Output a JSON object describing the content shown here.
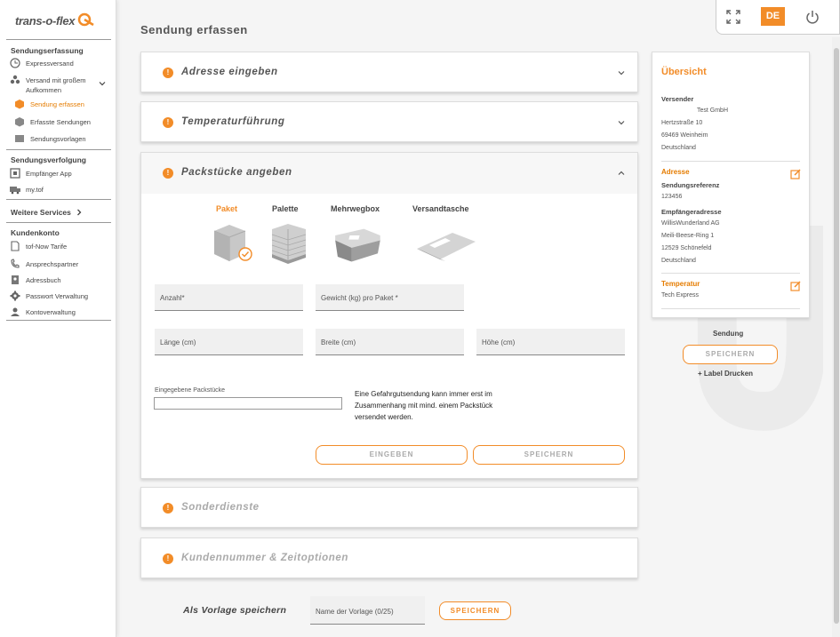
{
  "brand": {
    "logo_text": "trans-o-flex",
    "accent": "#f28c28"
  },
  "sidebar": {
    "sections": [
      {
        "title": "Sendungserfassung",
        "items": [
          {
            "label": "Expressversand",
            "icon": "clock-icon"
          },
          {
            "label": "Versand mit großem Aufkommen",
            "icon": "boxes-icon"
          },
          {
            "label": "Sendung erfassen",
            "icon": "box-icon"
          },
          {
            "label": "Erfasste Sendungen",
            "icon": "box-list-icon"
          },
          {
            "label": "Sendungsvorlagen",
            "icon": "box-template-icon"
          }
        ]
      },
      {
        "title": "Sendungsverfolgung",
        "items": [
          {
            "label": "Empfänger App",
            "icon": "app-icon"
          },
          {
            "label": "my.tof",
            "icon": "truck-icon"
          }
        ]
      },
      {
        "title": "Weitere Services"
      },
      {
        "title": "Kundenkonto",
        "items": [
          {
            "label": "tof-Now Tarife",
            "icon": "pdf-icon"
          },
          {
            "label": "Ansprechspartner",
            "icon": "phone-icon"
          },
          {
            "label": "Adressbuch",
            "icon": "addressbook-icon"
          },
          {
            "label": "Passwort Verwaltung",
            "icon": "gear-icon"
          },
          {
            "label": "Kontoverwaltung",
            "icon": "user-icon"
          }
        ]
      }
    ]
  },
  "top": {
    "lang": "DE"
  },
  "page_title": "Sendung erfassen",
  "cards": {
    "address": "Adresse eingeben",
    "temperature": "Temperaturführung",
    "packages": "Packstücke angeben",
    "special": "Sonderdienste",
    "customer": "Kundennummer & Zeitoptionen"
  },
  "package_types": [
    "Paket",
    "Palette",
    "Mehrwegbox",
    "Versandtasche"
  ],
  "fields": {
    "anzahl": "Anzahl*",
    "gewicht": "Gewicht (kg) pro Paket *",
    "laenge": "Länge (cm)",
    "breite": "Breite (cm)",
    "hoehe": "Höhe (cm)"
  },
  "entered_label": "Eingegebene Packstücke",
  "hazard_note": "Eine Gefahrgutsendung kann immer erst im Zusammenhang mit mind. einem Packstück versendet werden.",
  "buttons": {
    "eingeben": "EINGEBEN",
    "speichern": "SPEICHERN"
  },
  "overview": {
    "title": "Übersicht",
    "versender_label": "Versender",
    "versender": [
      "Test GmbH",
      "Hertzstraße 10",
      "69469 Weinheim",
      "Deutschland"
    ],
    "adresse_label": "Adresse",
    "ref_label": "Sendungsreferenz",
    "ref": "123456",
    "empf_label": "Empfängeradresse",
    "empf": [
      "WillisWunderland AG",
      "Meili-Beese-Ring 1",
      "12529 Schönefeld",
      "Deutschland"
    ],
    "temp_label": "Temperatur",
    "temp": "Tech Express"
  },
  "sendung": {
    "label": "Sendung",
    "save": "SPEICHERN",
    "print": "+ Label Drucken"
  },
  "vorlage": {
    "label": "Als Vorlage speichern",
    "placeholder": "Name der Vorlage (0/25)",
    "save": "SPEICHERN"
  }
}
